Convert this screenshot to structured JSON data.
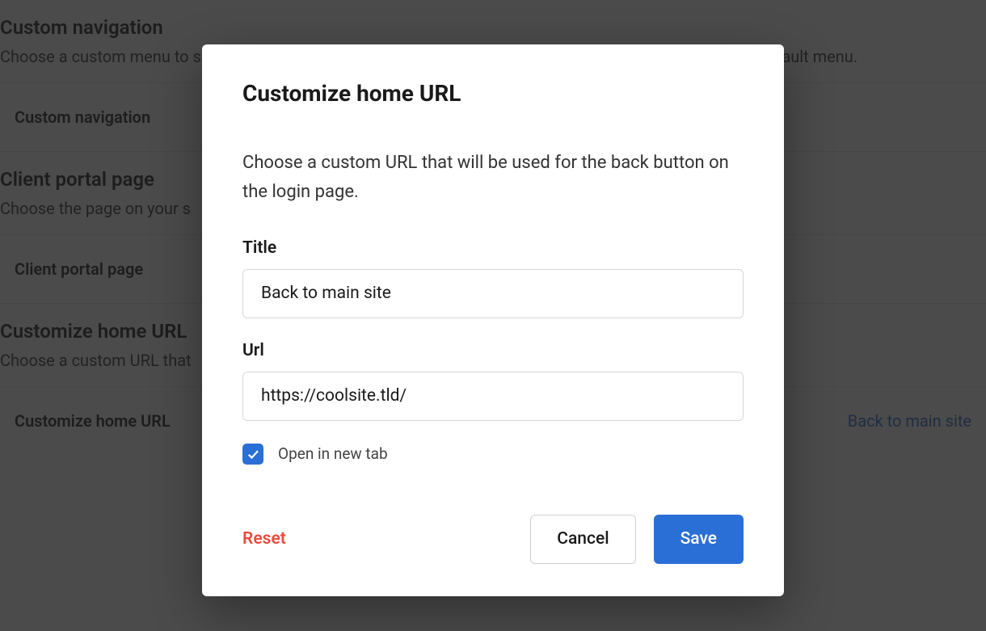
{
  "background": {
    "customNav": {
      "heading": "Custom navigation",
      "desc": "Choose a custom menu to show when someone visits client portal. This menu will show up instead of the default menu.",
      "rowTitle": "Custom navigation"
    },
    "portalPage": {
      "heading": "Client portal page",
      "desc": "Choose the page on your s",
      "rowTitle": "Client portal page"
    },
    "homeUrl": {
      "heading": "Customize home URL",
      "desc": "Choose a custom URL that",
      "rowTitle": "Customize home URL",
      "rowValue": "Back to main site"
    }
  },
  "dialog": {
    "title": "Customize home URL",
    "desc": "Choose a custom URL that will be used for the back button on the login page.",
    "titleField": {
      "label": "Title",
      "value": "Back to main site"
    },
    "urlField": {
      "label": "Url",
      "value": "https://coolsite.tld/"
    },
    "openNewTab": {
      "label": "Open in new tab",
      "checked": true
    },
    "actions": {
      "reset": "Reset",
      "cancel": "Cancel",
      "save": "Save"
    }
  }
}
